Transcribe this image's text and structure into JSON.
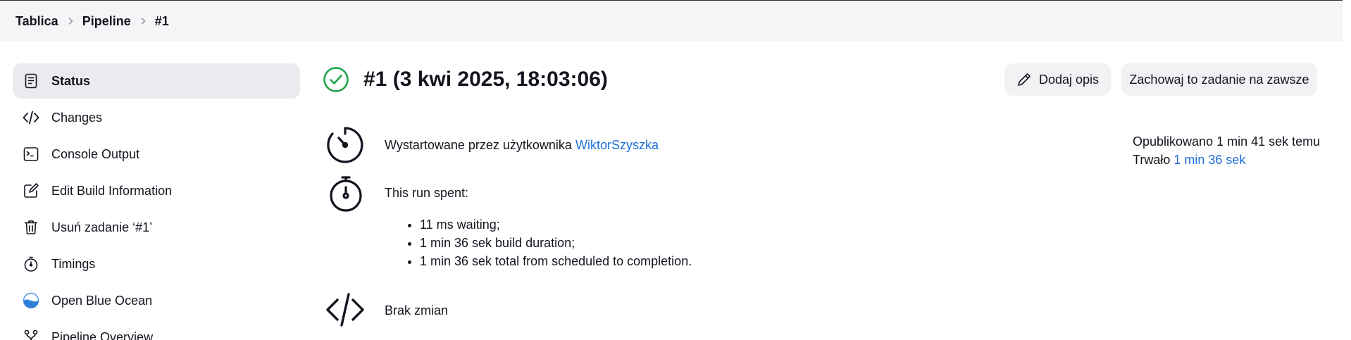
{
  "breadcrumb": {
    "items": [
      "Tablica",
      "Pipeline",
      "#1"
    ]
  },
  "sidebar": {
    "items": [
      {
        "label": "Status",
        "icon": "document-icon",
        "active": true
      },
      {
        "label": "Changes",
        "icon": "code-icon"
      },
      {
        "label": "Console Output",
        "icon": "terminal-icon"
      },
      {
        "label": "Edit Build Information",
        "icon": "edit-icon"
      },
      {
        "label": "Usuń zadanie ‘#1’",
        "icon": "trash-icon"
      },
      {
        "label": "Timings",
        "icon": "stopwatch-icon"
      },
      {
        "label": "Open Blue Ocean",
        "icon": "blue-ocean-icon"
      },
      {
        "label": "Pipeline Overview",
        "icon": "pipeline-icon"
      }
    ]
  },
  "build": {
    "title": "#1 (3 kwi 2025, 18:03:06)",
    "status": "success"
  },
  "actions": {
    "add_description": "Dodaj opis",
    "keep_forever": "Zachowaj to zadanie na zawsze"
  },
  "started": {
    "prefix": "Wystartowane przez użytkownika",
    "user": "WiktorSzyszka"
  },
  "run_spent": {
    "heading": "This run spent:",
    "items": [
      "11 ms waiting;",
      "1 min 36 sek build duration;",
      "1 min 36 sek total from scheduled to completion."
    ]
  },
  "changes": {
    "text": "Brak zmian"
  },
  "meta": {
    "published": "Opublikowano 1 min 41 sek temu",
    "duration_prefix": "Trwało",
    "duration": "1 min 36 sek"
  },
  "colors": {
    "success": "#1ea446",
    "link": "#1a6fd8",
    "topbar_bg": "#f5f5f7",
    "active_bg": "#ebebef"
  }
}
